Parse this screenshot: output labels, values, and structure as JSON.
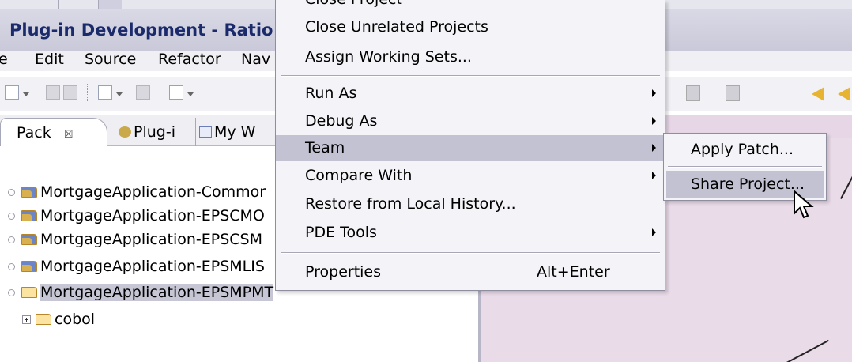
{
  "window": {
    "title": "Plug-in Development - Ratio"
  },
  "menubar": {
    "items": [
      "e",
      "Edit",
      "Source",
      "Refactor",
      "Nav"
    ]
  },
  "view_tabs": {
    "package_tab": "Pack",
    "close_glyph": "〈〉",
    "close_symbol": "☒",
    "plugin_tab": "Plug-i",
    "working_sets_tab": "My W"
  },
  "tree": {
    "rows": [
      {
        "label": "MortgageApplication-Commor"
      },
      {
        "label": "MortgageApplication-EPSCMO"
      },
      {
        "label": "MortgageApplication-EPSCSM"
      },
      {
        "label": "MortgageApplication-EPSMLIS"
      },
      {
        "label": "MortgageApplication-EPSMPMT"
      }
    ],
    "child": {
      "label": "cobol"
    }
  },
  "context_menu": {
    "partial_top": "Close Project",
    "items": [
      {
        "label": "Close Unrelated Projects"
      },
      {
        "label": "Assign Working Sets..."
      },
      {
        "label": "Run As",
        "submenu": true
      },
      {
        "label": "Debug As",
        "submenu": true
      },
      {
        "label": "Team",
        "submenu": true,
        "highlighted": true
      },
      {
        "label": "Compare With",
        "submenu": true
      },
      {
        "label": "Restore from Local History..."
      },
      {
        "label": "PDE Tools",
        "submenu": true
      },
      {
        "label": "Properties",
        "accelerator": "Alt+Enter"
      }
    ]
  },
  "team_submenu": {
    "items": [
      {
        "label": "Apply Patch..."
      },
      {
        "label": "Share Project...",
        "highlighted": true
      }
    ]
  },
  "colors": {
    "menu_bg": "#f4f4f8",
    "menu_highlight": "#c2c2d2",
    "editor_bg": "#eadbe9",
    "title_text": "#1a2a6a"
  }
}
